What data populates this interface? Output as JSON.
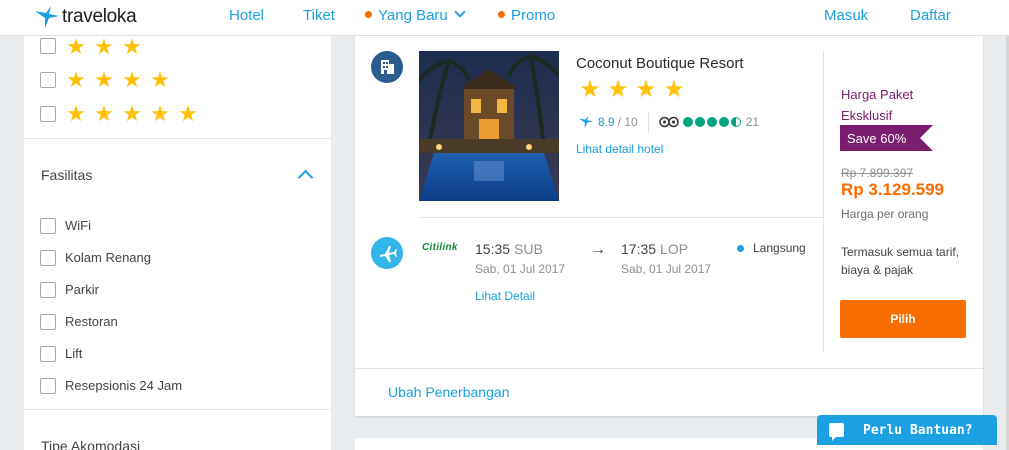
{
  "header": {
    "logo_text": "traveloka",
    "nav": {
      "hotel": "Hotel",
      "tiket": "Tiket",
      "yang_baru": "Yang Baru",
      "promo": "Promo",
      "masuk": "Masuk",
      "daftar": "Daftar"
    }
  },
  "sidebar": {
    "star_filters": [
      {
        "stars": 3,
        "checked": false
      },
      {
        "stars": 4,
        "checked": false
      },
      {
        "stars": 5,
        "checked": false
      }
    ],
    "facilities": {
      "title": "Fasilitas",
      "items": [
        "WiFi",
        "Kolam Renang",
        "Parkir",
        "Restoran",
        "Lift",
        "Resepsionis 24 Jam"
      ]
    },
    "next_section_title": "Tipe Akomodasi"
  },
  "package": {
    "hotel_name": "Coconut Boutique Resort",
    "hotel_stars": 4,
    "score": "8.9",
    "score_max": "/ 10",
    "tripadvisor_rating": 4.5,
    "review_count": "21",
    "detail_link": "Lihat detail hotel",
    "flight": {
      "airline": "Citilink",
      "depart_time": "15:35",
      "depart_code": "SUB",
      "depart_date": "Sab, 01 Jul 2017",
      "arrow": "→",
      "arrive_time": "17:35",
      "arrive_code": "LOP",
      "arrive_date": "Sab, 01 Jul 2017",
      "type": "Langsung",
      "detail_link": "Lihat Detail"
    },
    "price": {
      "label": "Harga Paket Eksklusif",
      "save": "Save 60%",
      "old_price": "Rp 7.899.397",
      "price": "Rp 3.129.599",
      "per_person": "Harga per orang",
      "included": "Termasuk semua tarif, biaya & pajak",
      "button": "Pilih"
    },
    "change_flight": "Ubah Penerbangan"
  },
  "help": {
    "label": "Perlu Bantuan?"
  },
  "colors": {
    "accent": "#1ba0e2",
    "orange": "#f96d01",
    "purple": "#7a1d6e",
    "star": "#ffc107"
  }
}
